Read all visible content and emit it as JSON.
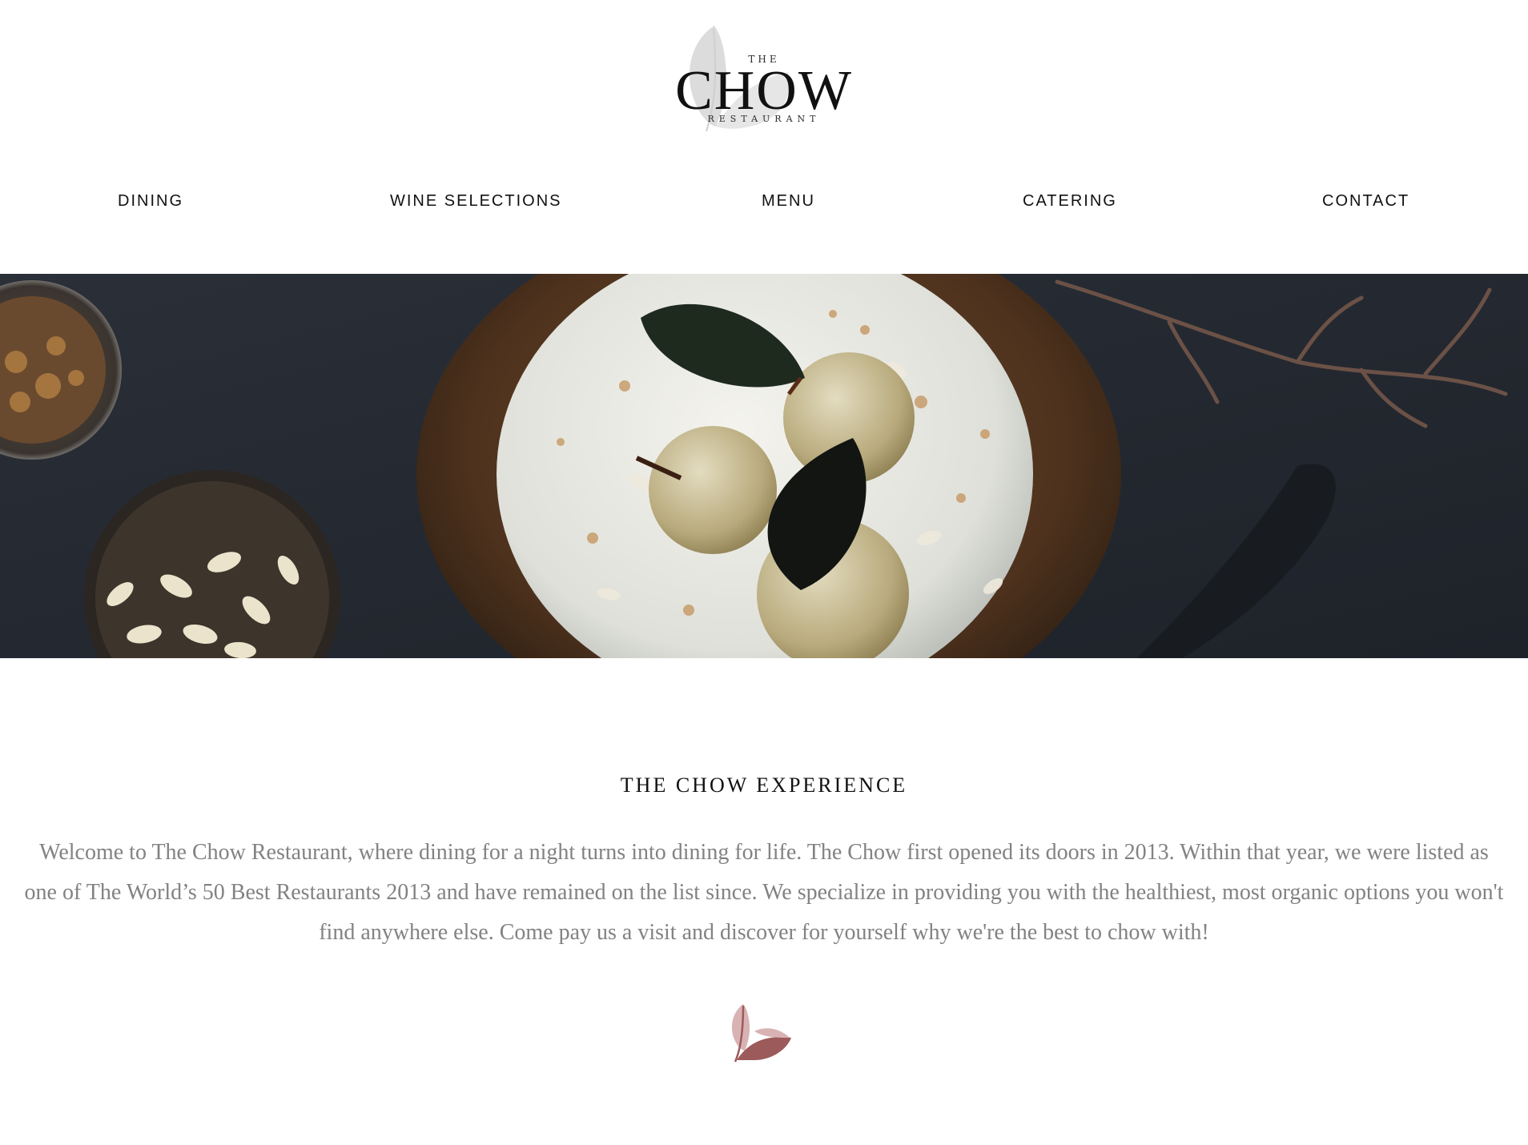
{
  "brand": {
    "logo_the": "THE",
    "logo_name": "CHOW",
    "logo_sub": "RESTAURANT",
    "logo_leaf_color": "#d9d9d9"
  },
  "nav": {
    "items": [
      {
        "label": "DINING"
      },
      {
        "label": "WINE SELECTIONS"
      },
      {
        "label": "MENU"
      },
      {
        "label": "CATERING"
      },
      {
        "label": "CONTACT"
      }
    ]
  },
  "hero": {
    "image": "dessert-photo",
    "subject": "poached pears on cream cake with almonds"
  },
  "experience": {
    "title": "THE CHOW EXPERIENCE",
    "body": "Welcome to The Chow Restaurant, where dining for a night turns into dining for life. The Chow first opened its doors in 2013. Within that year, we were listed as one of The World’s 50 Best Restaurants 2013 and have remained on the list since. We specialize in providing you with the healthiest, most organic options you won't find anywhere else. Come pay us a visit and discover for yourself why we're the best to chow with!"
  },
  "ornament": {
    "icon": "leaf-icon",
    "color_dark": "#9c5a5a",
    "color_light": "#d9b3b3"
  },
  "colors": {
    "text": "#111111",
    "body_text": "#828282",
    "hero_bg": "#23272f"
  }
}
